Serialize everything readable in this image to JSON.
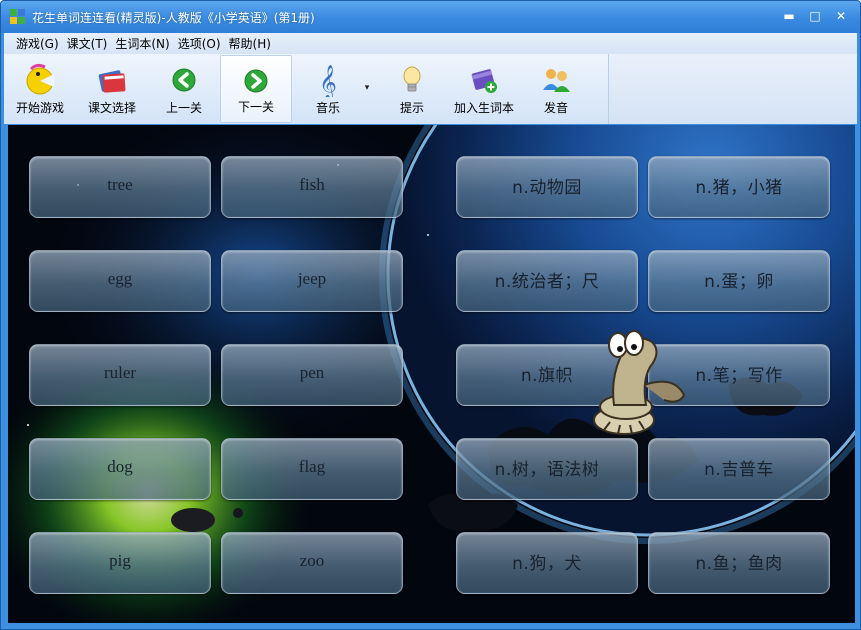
{
  "window": {
    "title": "花生单词连连看(精灵版)-人教版《小学英语》(第1册)",
    "controls": {
      "minimize": "▬",
      "maximize": "□",
      "close": "✕"
    }
  },
  "menu": {
    "items": [
      "游戏(G)",
      "课文(T)",
      "生词本(N)",
      "选项(O)",
      "帮助(H)"
    ]
  },
  "toolbar": {
    "buttons": [
      {
        "label": "开始游戏",
        "icon": "pacman-icon"
      },
      {
        "label": "课文选择",
        "icon": "books-icon"
      },
      {
        "label": "上一关",
        "icon": "arrow-left-icon"
      },
      {
        "label": "下一关",
        "icon": "arrow-right-icon",
        "active": true
      },
      {
        "label": "音乐",
        "icon": "treble-clef-icon"
      },
      {
        "label": "提示",
        "icon": "lightbulb-icon"
      },
      {
        "label": "加入生词本",
        "icon": "book-add-icon"
      },
      {
        "label": "发音",
        "icon": "speaker-people-icon"
      }
    ],
    "music_dropdown": "▾"
  },
  "cards": {
    "english": [
      "tree",
      "fish",
      "egg",
      "jeep",
      "ruler",
      "pen",
      "dog",
      "flag",
      "pig",
      "zoo"
    ],
    "chinese": [
      "n.动物园",
      "n.猪，小猪",
      "n.统治者；尺",
      "n.蛋；卵",
      "n.旗帜",
      "n.笔；写作",
      "n.树，语法树",
      "n.吉普车",
      "n.狗，犬",
      "n.鱼；鱼肉"
    ]
  },
  "colors": {
    "titlebar": "#3a8ae0",
    "menubar": "#dde8f6",
    "card_text": "#18222e",
    "background": "#02060f"
  }
}
